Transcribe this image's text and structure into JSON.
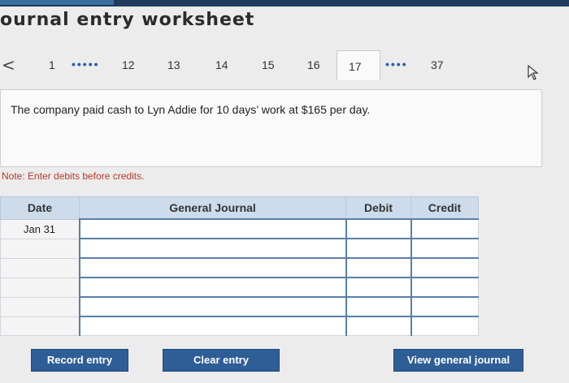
{
  "header": {
    "worksheet_title": "ournal entry worksheet"
  },
  "nav": {
    "prev_icon": "chevron-left-icon",
    "items": [
      "1",
      "12",
      "13",
      "14",
      "15",
      "16",
      "17",
      "37"
    ],
    "ellipsis": "•••••",
    "ellipsis_short": "••••",
    "active_item": "17"
  },
  "question": {
    "text": "The company paid cash to Lyn Addie for 10 days’ work at $165 per day."
  },
  "note": {
    "text": "Note: Enter debits before credits."
  },
  "journal": {
    "columns": [
      "Date",
      "General Journal",
      "Debit",
      "Credit"
    ],
    "rows": [
      {
        "date": "Jan 31",
        "account": "",
        "debit": "",
        "credit": ""
      },
      {
        "date": "",
        "account": "",
        "debit": "",
        "credit": ""
      },
      {
        "date": "",
        "account": "",
        "debit": "",
        "credit": ""
      },
      {
        "date": "",
        "account": "",
        "debit": "",
        "credit": ""
      },
      {
        "date": "",
        "account": "",
        "debit": "",
        "credit": ""
      },
      {
        "date": "",
        "account": "",
        "debit": "",
        "credit": ""
      }
    ]
  },
  "buttons": {
    "record": "Record entry",
    "clear": "Clear entry",
    "view": "View general journal"
  },
  "colors": {
    "button_blue": "#2e5e96",
    "header_blue": "#cddcec",
    "note_red": "#b53a2b",
    "dots_blue": "#2a5db0"
  }
}
